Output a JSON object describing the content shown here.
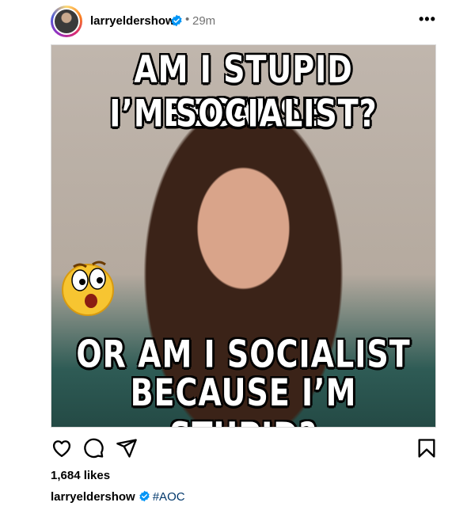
{
  "post": {
    "username": "larryeldershow",
    "separator": "•",
    "time": "29m",
    "more_label": "•••"
  },
  "meme": {
    "top_line_1": "AM I STUPID BECAUSE",
    "top_line_2": "I’M SOCIALIST?",
    "bottom_line_1": "OR AM I SOCIALIST",
    "bottom_line_2": "BECAUSE I’M STUPID?"
  },
  "engagement": {
    "likes": "1,684 likes"
  },
  "caption": {
    "username": "larryeldershow",
    "hashtag": "#AOC"
  },
  "icons": {
    "like": "heart-icon",
    "comment": "comment-icon",
    "share": "share-icon",
    "save": "bookmark-icon",
    "verified": "verified-badge-icon"
  },
  "colors": {
    "verified": "#0095f6",
    "hashtag": "#00376b",
    "meta": "#737373"
  }
}
